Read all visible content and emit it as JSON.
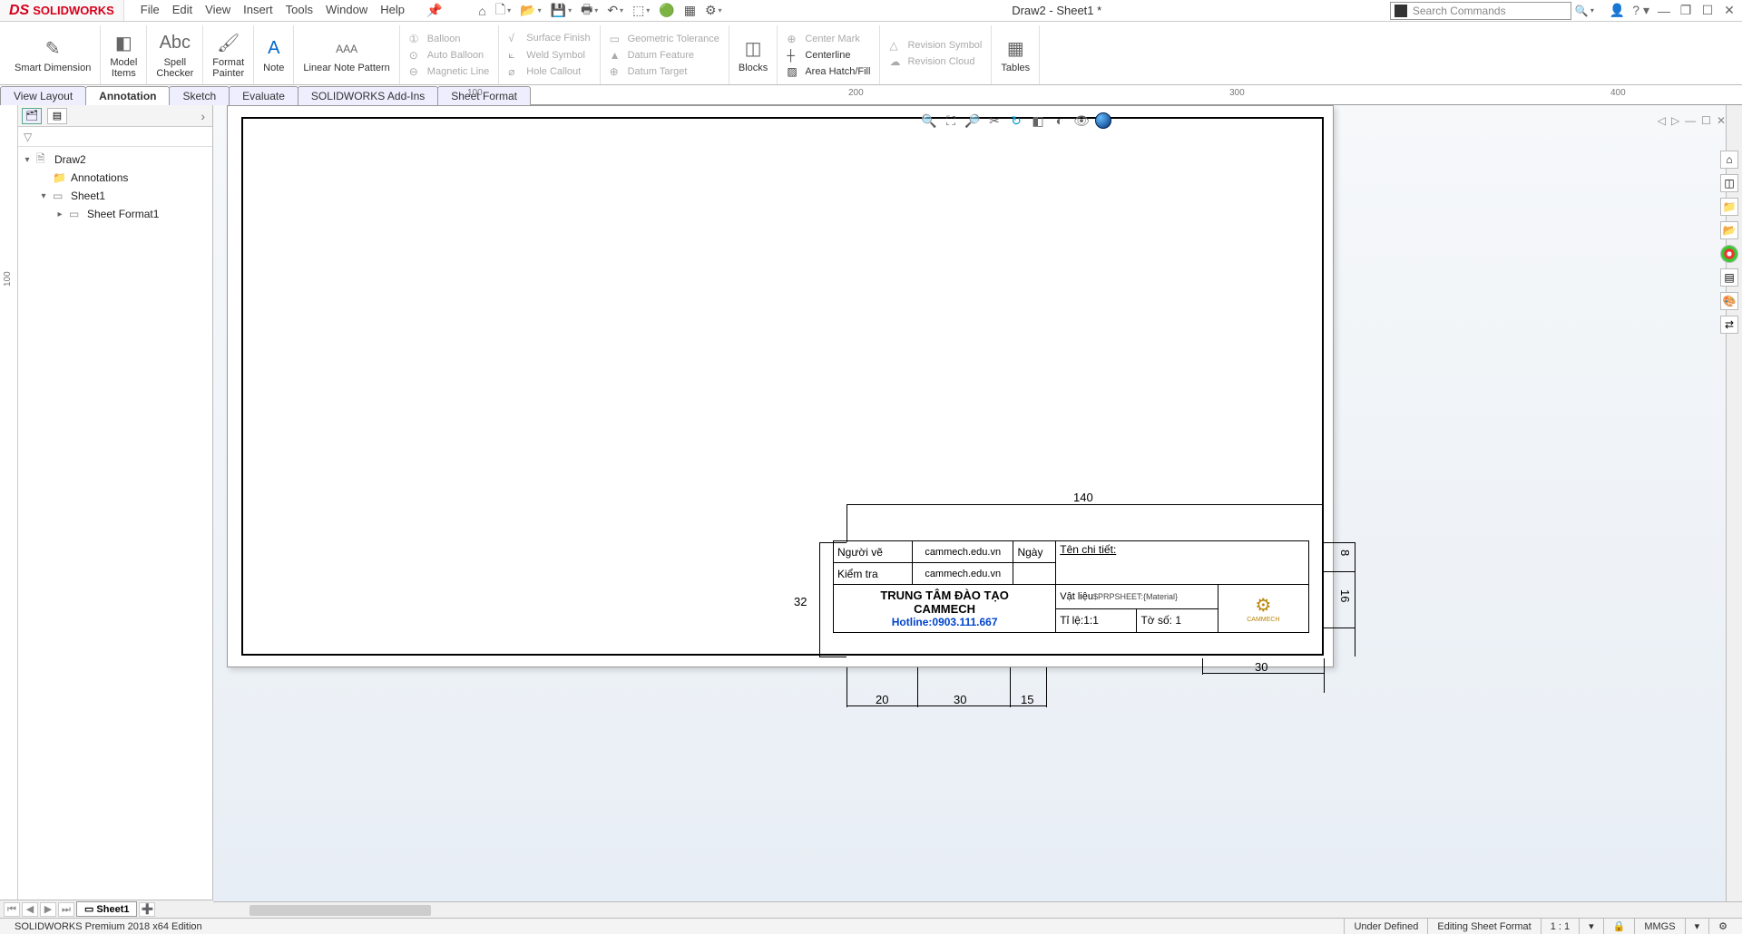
{
  "app": {
    "logo_text": "SOLIDWORKS",
    "title": "Draw2 - Sheet1 *",
    "search_placeholder": "Search Commands"
  },
  "menu": [
    "File",
    "Edit",
    "View",
    "Insert",
    "Tools",
    "Window",
    "Help"
  ],
  "ribbon": {
    "smart_dimension": "Smart Dimension",
    "model_items": "Model\nItems",
    "spell_checker": "Spell\nChecker",
    "format_painter": "Format\nPainter",
    "note": "Note",
    "linear_note_pattern": "Linear Note Pattern",
    "balloon": "Balloon",
    "auto_balloon": "Auto Balloon",
    "magnetic_line": "Magnetic Line",
    "surface_finish": "Surface Finish",
    "weld_symbol": "Weld Symbol",
    "hole_callout": "Hole Callout",
    "geometric_tolerance": "Geometric Tolerance",
    "datum_feature": "Datum Feature",
    "datum_target": "Datum Target",
    "blocks": "Blocks",
    "center_mark": "Center Mark",
    "centerline": "Centerline",
    "area_hatch": "Area Hatch/Fill",
    "revision_symbol": "Revision Symbol",
    "revision_cloud": "Revision Cloud",
    "tables": "Tables"
  },
  "tabs": [
    "View Layout",
    "Annotation",
    "Sketch",
    "Evaluate",
    "SOLIDWORKS Add-Ins",
    "Sheet Format"
  ],
  "active_tab": "Annotation",
  "ruler_h": {
    "t100": "100",
    "t200": "200",
    "t300": "300",
    "t400": "400"
  },
  "ruler_v": {
    "t100": "100"
  },
  "tree": {
    "root": "Draw2",
    "annotations": "Annotations",
    "sheet": "Sheet1",
    "sheet_format": "Sheet Format1"
  },
  "title_block": {
    "nguoi_ve_label": "Người vẽ",
    "nguoi_ve_value": "cammech.edu.vn",
    "ngay_label": "Ngày",
    "kiem_tra_label": "Kiểm tra",
    "kiem_tra_value": "cammech.edu.vn",
    "ten_chi_tiet": "Tên chi tiết:",
    "org_line1": "TRUNG TÂM ĐÀO TẠO",
    "org_line2": "CAMMECH",
    "hotline": "Hotline:0903.111.667",
    "vat_lieu": "Vật liệu",
    "material_prop": "$PRPSHEET:{Material}",
    "ti_le": "Tỉ lệ:1:1",
    "to_so": "Tờ số: 1"
  },
  "dims": {
    "d140": "140",
    "d32": "32",
    "d20": "20",
    "d30a": "30",
    "d15": "15",
    "d30b": "30",
    "d8": "8",
    "d16": "16"
  },
  "sheet_tab": "Sheet1",
  "status": {
    "edition": "SOLIDWORKS Premium 2018 x64 Edition",
    "under_defined": "Under Defined",
    "editing": "Editing Sheet Format",
    "scale": "1 : 1",
    "units": "MMGS"
  }
}
